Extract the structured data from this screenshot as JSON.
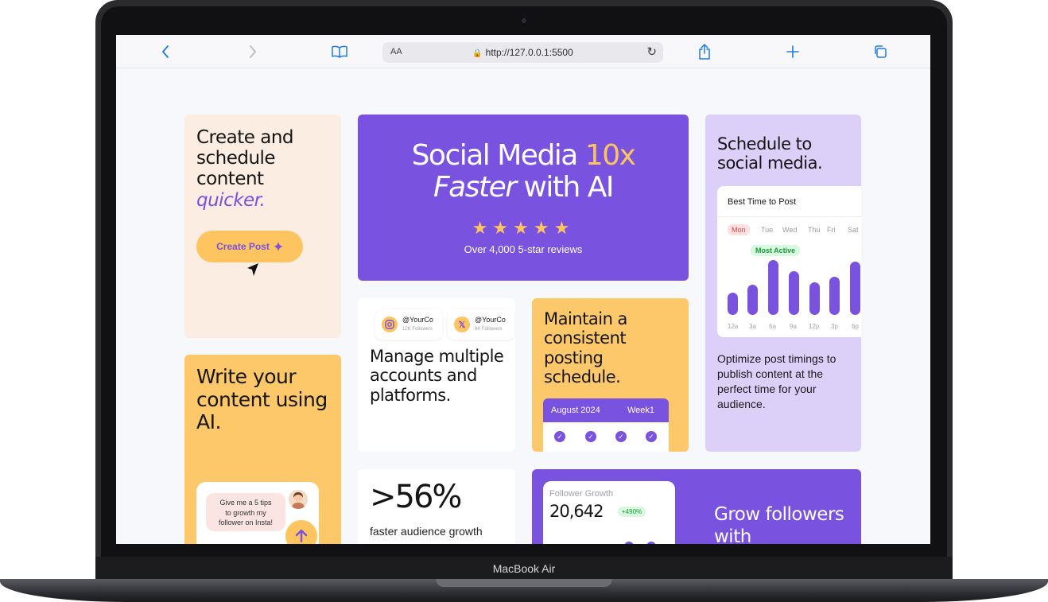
{
  "device": {
    "label": "MacBook Air"
  },
  "browser": {
    "text_size_label": "AA",
    "url": "http://127.0.0.1:5500"
  },
  "create_card": {
    "line1": "Create and",
    "line2": "schedule",
    "line3": "content",
    "accent": "quicker.",
    "button_label": "Create Post"
  },
  "hero": {
    "title_part1": "Social Media ",
    "title_highlight": "10x",
    "title_italic": "Faster",
    "title_part2": " with AI",
    "stars": "★★★★★",
    "rating": 5,
    "subtitle": "Over 4,000 5-star reviews"
  },
  "schedule_card": {
    "title": "Schedule to social media.",
    "panel_title": "Best Time to Post",
    "days": [
      "Mon",
      "Tue",
      "Wed",
      "Thu",
      "Fri",
      "Sat"
    ],
    "active_day": "Mon",
    "badge": "Most Active",
    "times": [
      "12a",
      "3a",
      "6a",
      "9a",
      "12p",
      "3p",
      "6p"
    ],
    "description": "Optimize post timings to publish content at the perfect time for your audience."
  },
  "write_card": {
    "title": "Write your content using AI.",
    "chat_line1": "Give me a 5 tips",
    "chat_line2": "to growth my",
    "chat_line3": "follower on Insta!"
  },
  "manage_card": {
    "accounts": [
      {
        "handle": "@YourCo",
        "followers": "12K Followers",
        "platform": "instagram"
      },
      {
        "handle": "@YourCo",
        "followers": "8K Followers",
        "platform": "x"
      }
    ],
    "title": "Manage multiple accounts and platforms."
  },
  "maintain_card": {
    "title": "Maintain a consistent posting schedule.",
    "calendar_month": "August 2024",
    "calendar_week": "Week1"
  },
  "stat_card": {
    "value": ">56%",
    "label": "faster audience growth"
  },
  "grow_card": {
    "panel_title": "Follower Growth",
    "value": "20,642",
    "badge": "+490%",
    "title": "Grow followers with"
  },
  "colors": {
    "brand_purple": "#7a52e0",
    "accent_yellow": "#fdc45f",
    "cream": "#fbede2",
    "lavender": "#dccff8"
  }
}
